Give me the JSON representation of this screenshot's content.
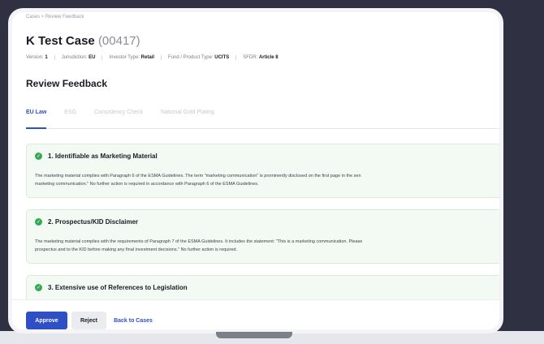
{
  "breadcrumb": "Cases  >  Review Feedback",
  "case": {
    "name": "K Test Case",
    "id": "(00417)"
  },
  "meta": [
    {
      "label": "Version:",
      "value": "1"
    },
    {
      "label": "Jurisdiction:",
      "value": "EU"
    },
    {
      "label": "Investor Type:",
      "value": "Retail"
    },
    {
      "label": "Fund / Product Type:",
      "value": "UCITS"
    },
    {
      "label": "SFDR:",
      "value": "Article 8"
    }
  ],
  "section_title": "Review Feedback",
  "tabs": [
    "EU Law",
    "ESG",
    "Consistency Check",
    "National Gold Plating"
  ],
  "cards": [
    {
      "title": "1. Identifiable as Marketing Material",
      "lines": [
        "The marketing material complies with Paragraph 6 of the ESMA Guidelines. The term \"marketing communication\" is prominently disclosed on the first page in the sen",
        "marketing communication.\" No further action is required in accordance with Paragraph 6 of the ESMA Guidelines."
      ]
    },
    {
      "title": "2. Prospectus/KID Disclaimer",
      "lines": [
        "The marketing material complies with the requirements of Paragraph 7 of the ESMA Guidelines. It includes the statement: \"This is a marketing communication. Please",
        "prospectus and to the KID before making any final investment decisions.\" No further action is required."
      ]
    },
    {
      "title": "3. Extensive use of References to Legislation",
      "lines": []
    }
  ],
  "actions": {
    "approve": "Approve",
    "reject": "Reject",
    "back": "Back to Cases"
  },
  "colors": {
    "accent": "#2f4fc4",
    "success": "#34a853",
    "frame": "#2f3042"
  }
}
